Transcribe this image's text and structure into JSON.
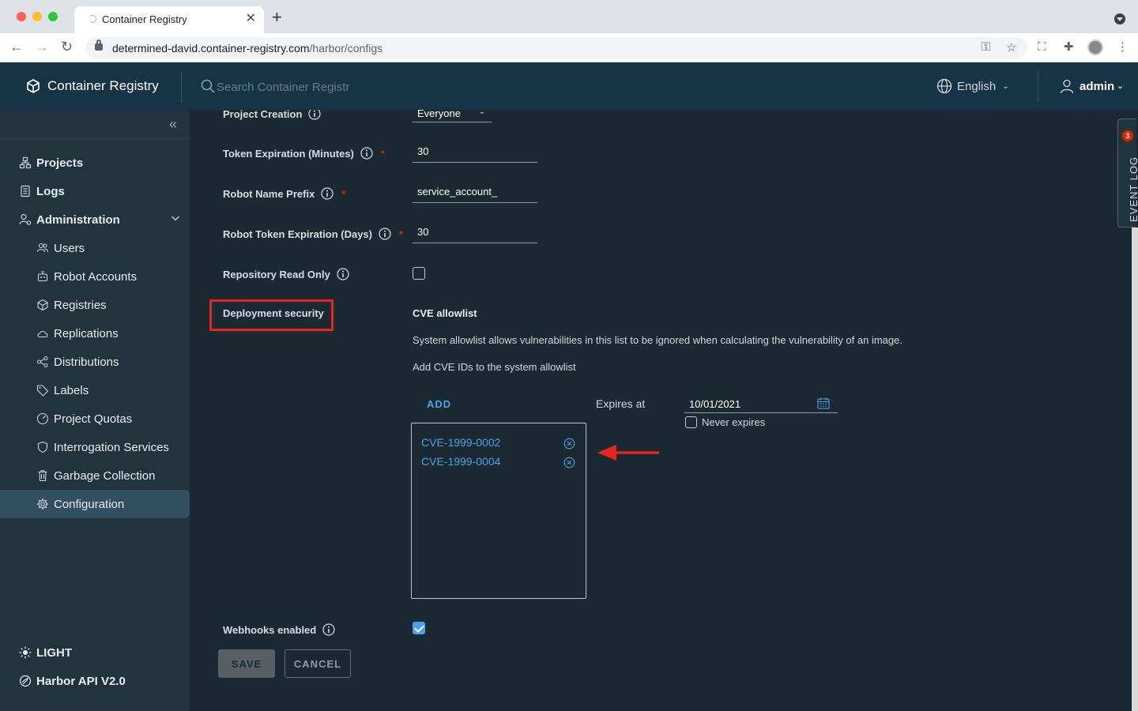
{
  "browser": {
    "tab_title": "Container Registry",
    "url_host": "determined-david.container-registry.com",
    "url_path": "/harbor/configs"
  },
  "header": {
    "brand": "Container Registry",
    "search_placeholder": "Search Container Registr",
    "language": "English",
    "user": "admin"
  },
  "sidebar": {
    "projects": "Projects",
    "logs": "Logs",
    "administration": "Administration",
    "admin_items": [
      {
        "label": "Users",
        "icon": "users-icon"
      },
      {
        "label": "Robot Accounts",
        "icon": "robot-icon"
      },
      {
        "label": "Registries",
        "icon": "cube-icon"
      },
      {
        "label": "Replications",
        "icon": "cloud-sync-icon"
      },
      {
        "label": "Distributions",
        "icon": "share-icon"
      },
      {
        "label": "Labels",
        "icon": "tag-icon"
      },
      {
        "label": "Project Quotas",
        "icon": "gauge-icon"
      },
      {
        "label": "Interrogation Services",
        "icon": "shield-icon"
      },
      {
        "label": "Garbage Collection",
        "icon": "trash-icon"
      },
      {
        "label": "Configuration",
        "icon": "gear-icon"
      }
    ],
    "active_item": "Configuration",
    "theme_toggle": "LIGHT",
    "api_link": "Harbor API V2.0"
  },
  "config": {
    "project_creation": {
      "label": "Project Creation",
      "value": "Everyone"
    },
    "token_expiration": {
      "label": "Token Expiration (Minutes)",
      "value": "30"
    },
    "robot_name_prefix": {
      "label": "Robot Name Prefix",
      "value": "service_account_"
    },
    "robot_token_expiration": {
      "label": "Robot Token Expiration (Days)",
      "value": "30"
    },
    "repository_read_only": {
      "label": "Repository Read Only",
      "checked": false
    },
    "deployment_security": {
      "label": "Deployment security",
      "section_title": "CVE allowlist",
      "description": "System allowlist allows vulnerabilities in this list to be ignored when calculating the vulnerability of an image.",
      "add_hint": "Add CVE IDs to the system allowlist",
      "add_button": "ADD",
      "expires_label": "Expires at",
      "expires_date": "10/01/2021",
      "never_expires_label": "Never expires",
      "never_expires_checked": false,
      "cves": [
        "CVE-1999-0002",
        "CVE-1999-0004"
      ]
    },
    "webhooks_enabled": {
      "label": "Webhooks enabled",
      "checked": true
    }
  },
  "actions": {
    "save": "SAVE",
    "cancel": "CANCEL"
  },
  "event_log": {
    "label": "EVENT LOG",
    "count": "3"
  },
  "colors": {
    "header_bg": "#173446",
    "sidebar_bg": "#21333b",
    "content_bg": "#1b2a32",
    "accent": "#4da2e8",
    "highlight": "#e4261f"
  }
}
